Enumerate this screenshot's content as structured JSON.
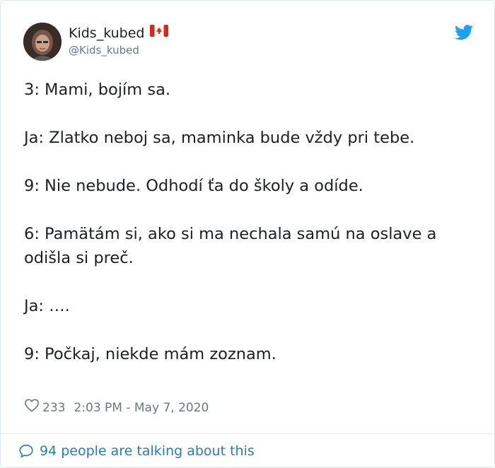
{
  "author": {
    "display_name": "Kids_kubed",
    "handle": "@Kids_kubed",
    "flag_icon": "canada-flag-icon",
    "avatar_icon": "profile-photo"
  },
  "brand": {
    "icon": "twitter-bird-icon",
    "color": "#1da1f2"
  },
  "tweet": {
    "lines": [
      "3: Mami, bojím sa.",
      "Ja: Zlatko neboj sa, maminka bude vždy pri tebe.",
      "9: Nie nebude. Odhodí ťa do školy a odíde.",
      "6: Pamätám si, ako si ma nechala samú na oslave a odišla si preč.",
      "Ja: ….",
      "9: Počkaj, niekde mám zoznam."
    ]
  },
  "meta": {
    "like_count": "233",
    "timestamp": "2:03 PM - May 7, 2020"
  },
  "footer": {
    "talking_label": "94 people are talking about this",
    "link_color": "#2b7bb9"
  }
}
